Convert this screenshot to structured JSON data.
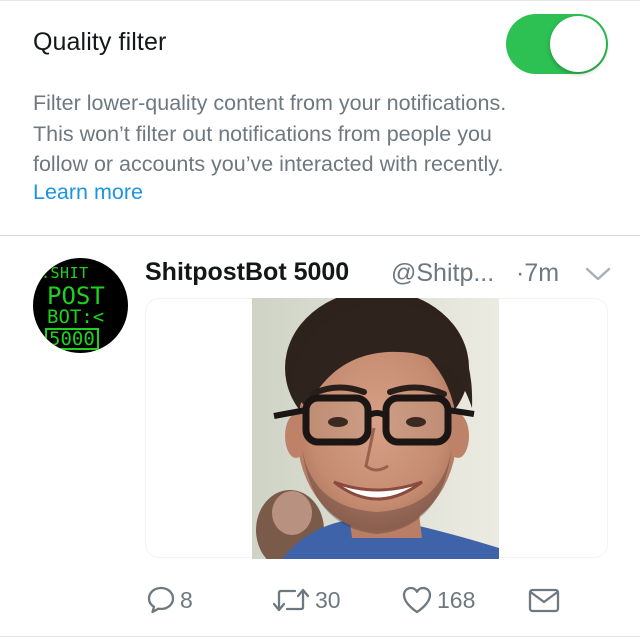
{
  "quality_filter": {
    "title": "Quality filter",
    "enabled": true,
    "description_lines": [
      "Filter lower-quality content from your notifications.",
      "This won’t filter out notifications from people you",
      "follow or accounts you’ve interacted with recently."
    ],
    "learn_more": "Learn more"
  },
  "tweet": {
    "avatar_text": [
      ":SHIT",
      "POST",
      "BOT:<",
      "5000"
    ],
    "name": "ShitpostBot 5000",
    "handle": "@Shitp...",
    "time": "·7m",
    "actions": {
      "reply_count": "8",
      "retweet_count": "30",
      "like_count": "168"
    }
  },
  "colors": {
    "accent": "#1b95e0",
    "toggle_on": "#2cc152",
    "muted_text": "#6e7880",
    "avatar_green": "#1fd11f"
  },
  "icons": {
    "caret": "chevron-down-icon",
    "reply": "speech-bubble-icon",
    "retweet": "retweet-arrows-icon",
    "like": "heart-icon",
    "dm": "envelope-icon"
  }
}
